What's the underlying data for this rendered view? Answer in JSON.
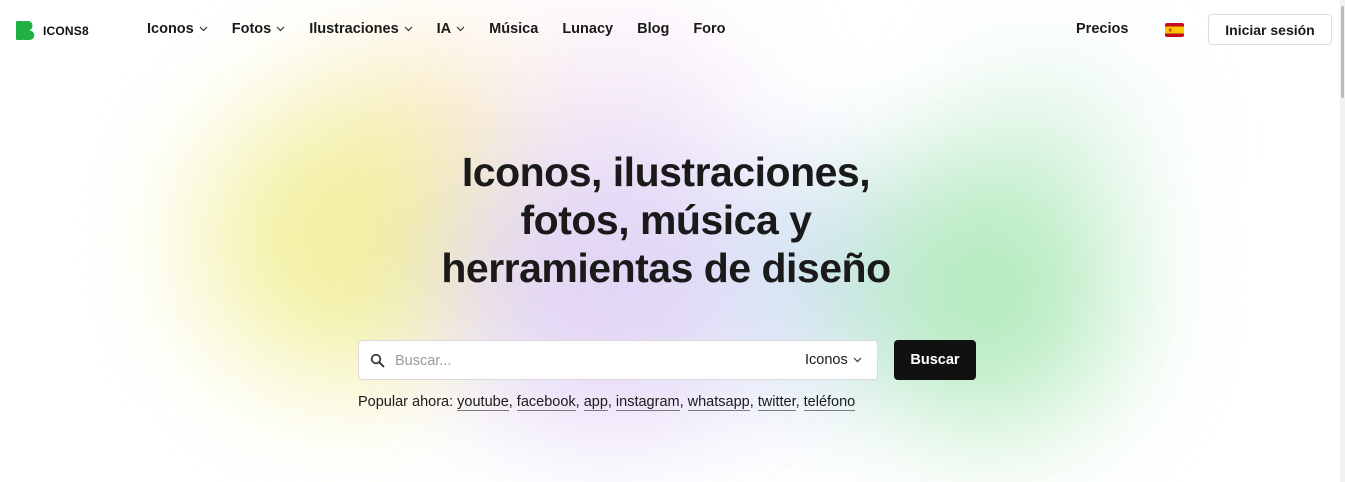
{
  "header": {
    "logo_text": "ICONS8",
    "nav": [
      {
        "label": "Iconos",
        "dropdown": true
      },
      {
        "label": "Fotos",
        "dropdown": true
      },
      {
        "label": "Ilustraciones",
        "dropdown": true
      },
      {
        "label": "IA",
        "dropdown": true
      },
      {
        "label": "Música",
        "dropdown": false
      },
      {
        "label": "Lunacy",
        "dropdown": false
      },
      {
        "label": "Blog",
        "dropdown": false
      },
      {
        "label": "Foro",
        "dropdown": false
      }
    ],
    "pricing_label": "Precios",
    "language_flag": "spain-flag-icon",
    "login_label": "Iniciar sesión"
  },
  "hero": {
    "title_lines": [
      "Iconos, ilustraciones,",
      "fotos, música y",
      "herramientas de diseño"
    ]
  },
  "search": {
    "placeholder": "Buscar...",
    "value": "",
    "type_selected": "Iconos",
    "button_label": "Buscar",
    "popular_label": "Popular ahora:",
    "popular_terms": [
      "youtube",
      "facebook",
      "app",
      "instagram",
      "whatsapp",
      "twitter",
      "teléfono"
    ]
  },
  "colors": {
    "brand_green": "#1fb141",
    "button_dark": "#111111",
    "text": "#1a1a1a"
  }
}
